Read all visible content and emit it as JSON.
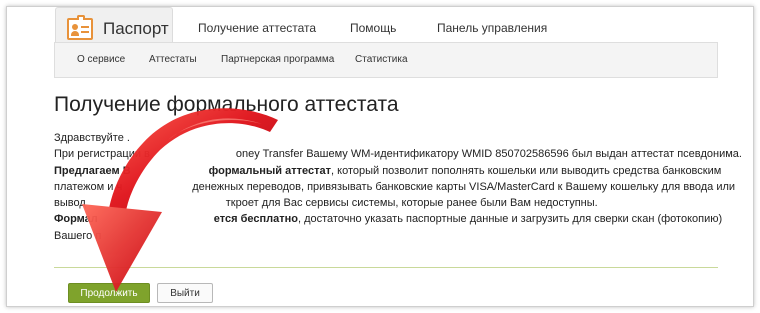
{
  "nav": {
    "passport_tab": "Паспорт",
    "items": [
      "Получение аттестата",
      "Помощь",
      "Панель управления"
    ]
  },
  "subnav": {
    "items": [
      "О сервисе",
      "Аттестаты",
      "Партнерская программа",
      "Статистика"
    ]
  },
  "page": {
    "title": "Получение формального аттестата",
    "greeting": "Здравствуйте .",
    "line1_prefix": "При регистрации в",
    "line1_rest": "oney Transfer Вашему WM-идентификатору WMID 850702586596 был выдан аттестат псевдонима.",
    "line2_bold_start": "Предлагаем В",
    "line2_bold_end": "формальный аттестат",
    "line2_rest": ", который позволит пополнять кошельки или выводить средства банковским",
    "line3_start": "платежом и ч",
    "line3_rest": "денежных переводов, привязывать банковские карты VISA/MasterCard к Вашему кошельку для ввода или",
    "line4_start": "вывод",
    "line4_rest": "ткроет для Вас сервисы системы, которые ранее были Вам недоступны.",
    "line5_bold_start": "Формал",
    "line5_bold_end": "ется бесплатно",
    "line5_rest": ", достаточно указать паспортные данные и загрузить для сверки скан (фотокопию)",
    "line6_start": "Вашего п"
  },
  "buttons": {
    "continue": "Продолжить",
    "exit": "Выйти"
  },
  "colors": {
    "accent_orange": "#e8923a",
    "continue_green": "#7fa32c",
    "arrow_red": "#e0141c"
  }
}
